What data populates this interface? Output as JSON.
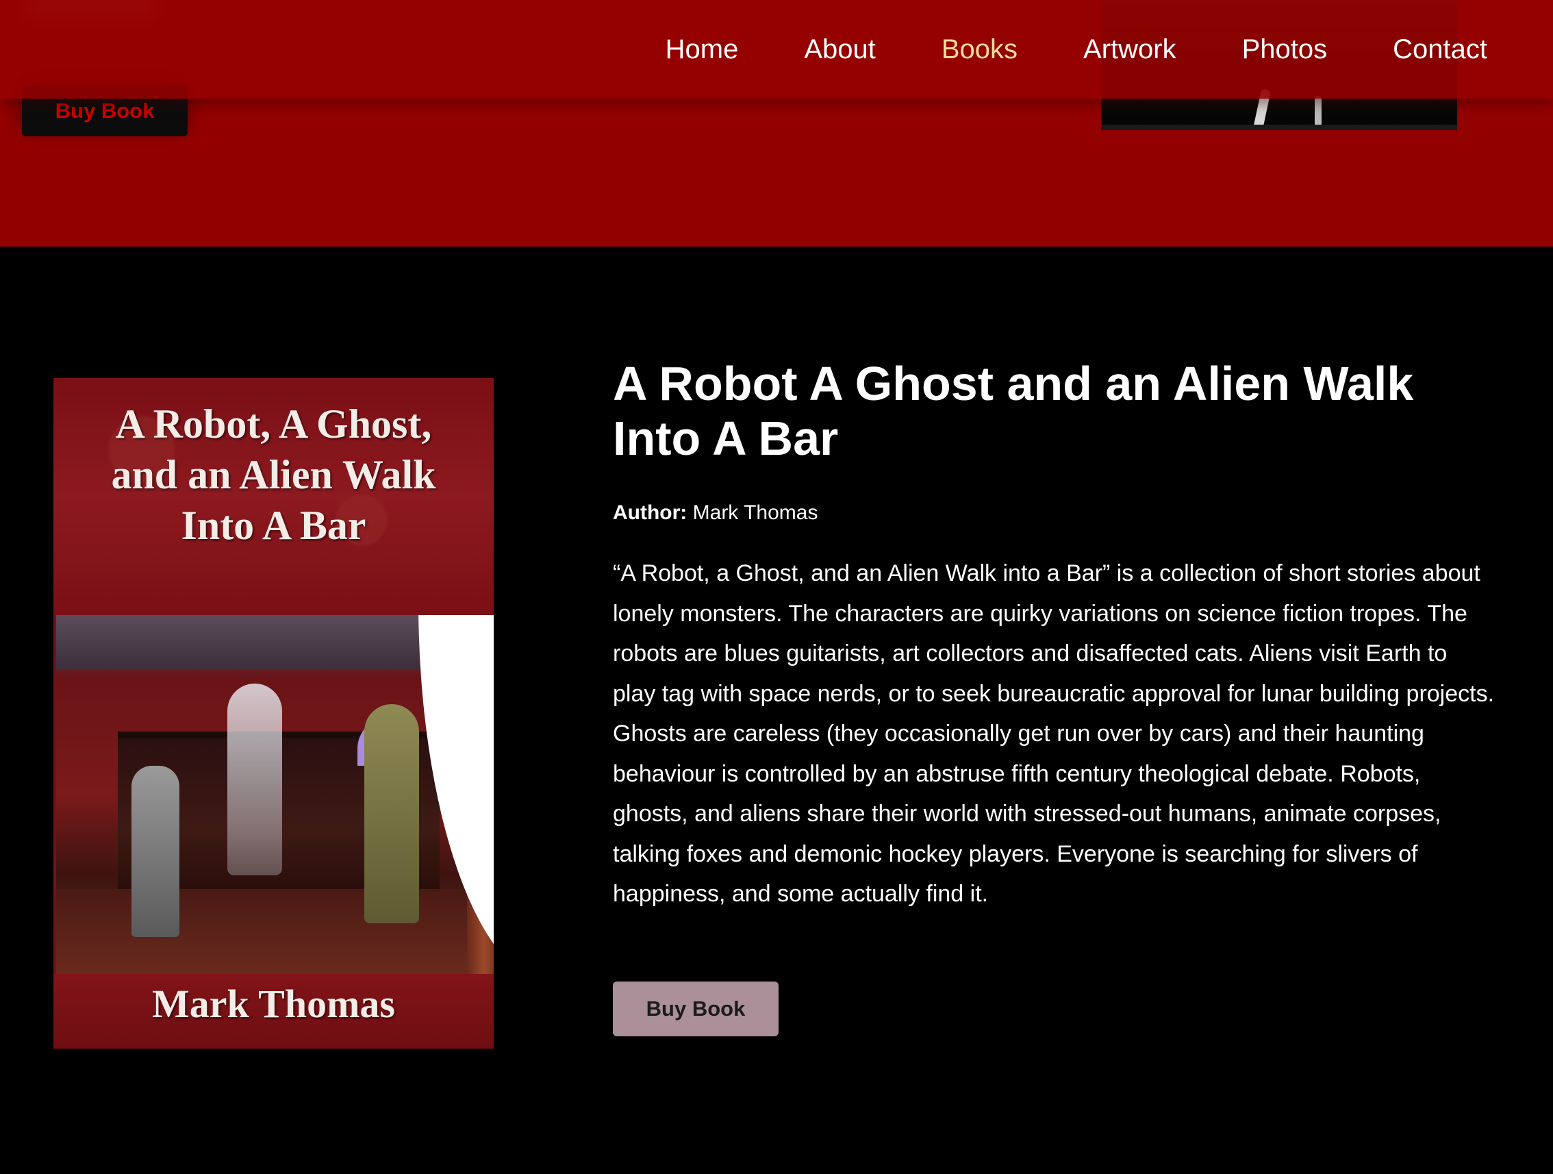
{
  "header": {
    "nav": [
      {
        "label": "Home"
      },
      {
        "label": "About"
      },
      {
        "label": "Books",
        "active": true
      },
      {
        "label": "Artwork"
      },
      {
        "label": "Photos"
      },
      {
        "label": "Contact"
      }
    ],
    "active_color": "#f7dd9b"
  },
  "top_section": {
    "buy_label": "Buy Book",
    "band_color": "#930000"
  },
  "book": {
    "title": "A Robot A Ghost and an Alien Walk Into A Bar",
    "author_label": "Author:",
    "author": "Mark Thomas",
    "description": "“A Robot, a Ghost, and an Alien Walk into a Bar” is a collection of short stories about lonely monsters. The characters are quirky variations on science fiction tropes. The robots are blues guitarists, art collectors and disaffected cats. Aliens visit Earth to play tag with space nerds, or to seek bureaucratic approval for lunar building projects. Ghosts are careless (they occasionally get run over by cars) and their haunting behaviour is controlled by an abstruse fifth century theological debate. Robots, ghosts, and aliens share their world with stressed-out humans, animate corpses, talking foxes and demonic hockey players. Everyone is searching for slivers of happiness, and some actually find it.",
    "buy_label": "Buy Book",
    "cover": {
      "title": "A Robot, A Ghost, and an Alien Walk Into A Bar",
      "author": "Mark Thomas"
    }
  }
}
